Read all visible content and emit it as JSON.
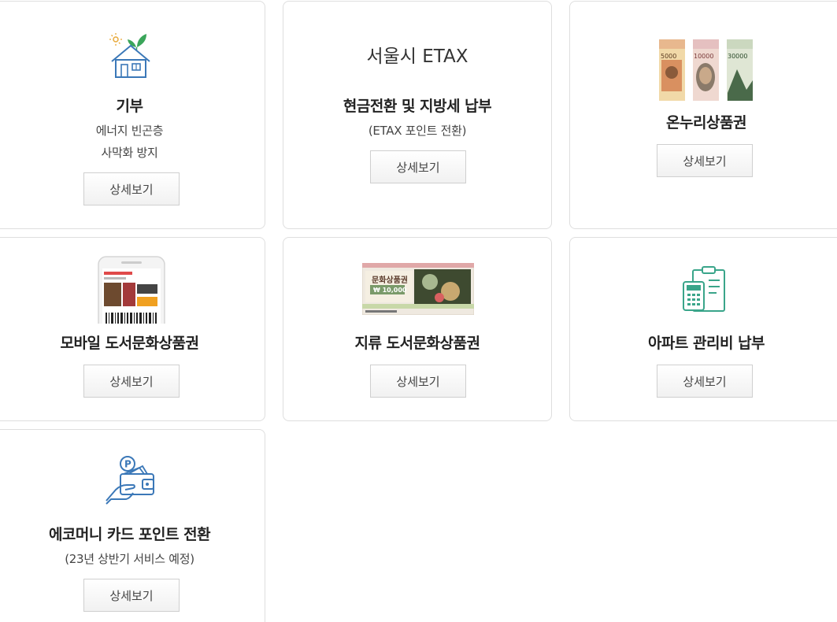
{
  "cards": [
    {
      "title": "기부",
      "sub1": "에너지 빈곤층",
      "sub2": "사막화 방지",
      "button": "상세보기",
      "icon": "house-sprout-icon"
    },
    {
      "logo": "서울시 ETAX",
      "title": "현금전환 및 지방세 납부",
      "sub1": "(ETAX 포인트 전환)",
      "button": "상세보기"
    },
    {
      "title": "온누리상품권",
      "button": "상세보기",
      "image": "onnuri-gift-certificates",
      "notes": [
        "5000",
        "10000",
        "30000"
      ]
    },
    {
      "title": "모바일 도서문화상품권",
      "button": "상세보기",
      "image": "mobile-phone-barcode"
    },
    {
      "title": "지류 도서문화상품권",
      "button": "상세보기",
      "image": "paper-gift-certificate",
      "ticket_title": "문화상품권",
      "ticket_amount": "₩ 10,000"
    },
    {
      "title": "아파트 관리비 납부",
      "button": "상세보기",
      "icon": "clipboard-calculator-icon"
    },
    {
      "title": "에코머니 카드 포인트 전환",
      "sub1": "(23년 상반기 서비스 예정)",
      "button": "상세보기",
      "icon": "wallet-points-icon"
    }
  ],
  "colors": {
    "accent_blue": "#3b78b8",
    "accent_green": "#3aa55a",
    "border": "#dedede"
  }
}
